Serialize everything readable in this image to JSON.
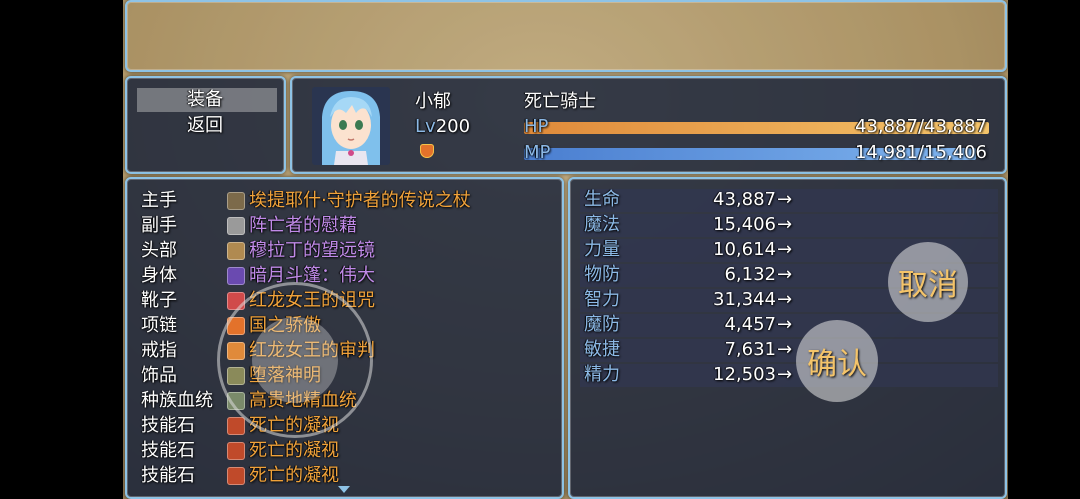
{
  "commands": [
    {
      "label": "装备",
      "selected": true
    },
    {
      "label": "返回",
      "selected": false
    }
  ],
  "actor": {
    "name": "小郁",
    "class": "死亡骑士",
    "level_label": "Lv",
    "level": "200",
    "hp_label": "HP",
    "hp_text": "43,887/43,887",
    "hp_fraction": 1.0,
    "mp_label": "MP",
    "mp_text": "14,981/15,406",
    "mp_fraction": 0.972,
    "portrait_icon": "blue-haired-girl-portrait",
    "state_icon": "shield-crest-icon"
  },
  "equipment": [
    {
      "slot": "主手",
      "item": "埃提耶什·守护者的传说之杖",
      "item_color": "#f0a23a",
      "icon": "staff-icon",
      "icon_color": "#7c6a4a"
    },
    {
      "slot": "副手",
      "item": "阵亡者的慰藉",
      "item_color": "#c08ae8",
      "icon": "orb-icon",
      "icon_color": "#9a9a9a"
    },
    {
      "slot": "头部",
      "item": "穆拉丁的望远镜",
      "item_color": "#c08ae8",
      "icon": "goggles-icon",
      "icon_color": "#b08a50"
    },
    {
      "slot": "身体",
      "item": "暗月斗篷：伟大",
      "item_color": "#c08ae8",
      "icon": "cloak-icon",
      "icon_color": "#6a4ab0"
    },
    {
      "slot": "靴子",
      "item": "红龙女王的诅咒",
      "item_color": "#f0a23a",
      "icon": "boots-icon",
      "icon_color": "#d04a4a"
    },
    {
      "slot": "项链",
      "item": "国之骄傲",
      "item_color": "#f0a23a",
      "icon": "crest-icon",
      "icon_color": "#e3722b"
    },
    {
      "slot": "戒指",
      "item": "红龙女王的审判",
      "item_color": "#f0a23a",
      "icon": "ring-icon",
      "icon_color": "#e08a3a"
    },
    {
      "slot": "饰品",
      "item": "堕落神明",
      "item_color": "#f0a23a",
      "icon": "trinket-icon",
      "icon_color": "#8a8a5a"
    },
    {
      "slot": "种族血统",
      "item": "高贵地精血统",
      "item_color": "#f0a23a",
      "icon": "goblin-icon",
      "icon_color": "#7a8a6a"
    },
    {
      "slot": "技能石",
      "item": "死亡的凝视",
      "item_color": "#f0a23a",
      "icon": "skill-rune-icon",
      "icon_color": "#c04a2a"
    },
    {
      "slot": "技能石",
      "item": "死亡的凝视",
      "item_color": "#f0a23a",
      "icon": "skill-rune-icon",
      "icon_color": "#c04a2a"
    },
    {
      "slot": "技能石",
      "item": "死亡的凝视",
      "item_color": "#f0a23a",
      "icon": "skill-rune-icon",
      "icon_color": "#c04a2a"
    }
  ],
  "params": [
    {
      "name": "生命",
      "value": "43,887",
      "arrow": "→"
    },
    {
      "name": "魔法",
      "value": "15,406",
      "arrow": "→"
    },
    {
      "name": "力量",
      "value": "10,614",
      "arrow": "→"
    },
    {
      "name": "物防",
      "value": "6,132",
      "arrow": "→"
    },
    {
      "name": "智力",
      "value": "31,344",
      "arrow": "→"
    },
    {
      "name": "魔防",
      "value": "4,457",
      "arrow": "→"
    },
    {
      "name": "敏捷",
      "value": "7,631",
      "arrow": "→"
    },
    {
      "name": "精力",
      "value": "12,503",
      "arrow": "→"
    }
  ],
  "buttons": {
    "cancel": "取消",
    "ok": "确认"
  },
  "colors": {
    "window_border": "#8ec3e6",
    "system_text": "#8cb9e6",
    "hp_gauge": "#e08a3a",
    "mp_gauge": "#4a7ed0"
  }
}
